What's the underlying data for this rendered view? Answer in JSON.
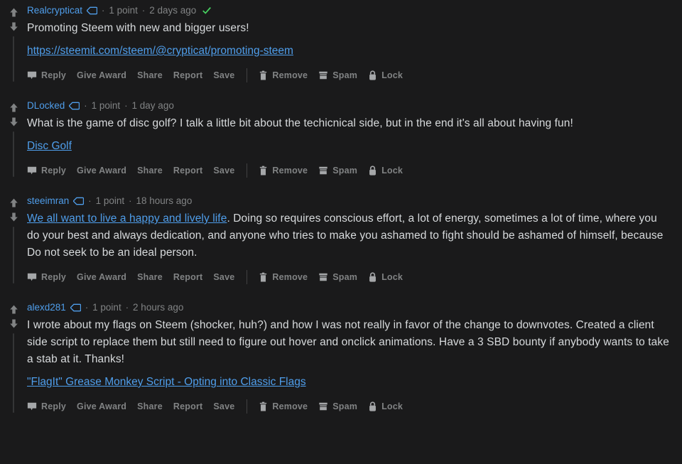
{
  "theme": {
    "background": "#1a1a1b",
    "text": "#d7dadc",
    "muted": "#818384",
    "link": "#4f9eeb",
    "threadline": "#343536",
    "verified_green": "#46d160",
    "icon_grey": "#818384"
  },
  "labels": {
    "points": "1 point",
    "separator": "·",
    "reply": "Reply",
    "give_award": "Give Award",
    "share": "Share",
    "report": "Report",
    "save": "Save",
    "remove": "Remove",
    "spam": "Spam",
    "lock": "Lock"
  },
  "icons": {
    "upvote": "upvote-arrow-icon",
    "downvote": "downvote-arrow-icon",
    "flair": "user-flair-tag-icon",
    "verified": "verified-checkmark-icon",
    "reply": "speech-bubble-icon",
    "remove": "trash-can-icon",
    "spam": "spam-box-icon",
    "lock": "padlock-icon"
  },
  "comments": [
    {
      "author": "Realcrypticat",
      "points": "1 point",
      "age": "2 days ago",
      "verified": true,
      "text": "Promoting Steem with new and bigger users!",
      "link_text": "https://steemit.com/steem/@crypticat/promoting-steem",
      "inline_link": null
    },
    {
      "author": "DLocked",
      "points": "1 point",
      "age": "1 day ago",
      "verified": false,
      "text": "What is the game of disc golf? I talk a little bit about the techicnical side, but in the end it's all about having fun!",
      "link_text": "Disc Golf",
      "inline_link": null
    },
    {
      "author": "steeimran",
      "points": "1 point",
      "age": "18 hours ago",
      "verified": false,
      "inline_link": "We all want to live a happy and lively life",
      "text": ". Doing so requires conscious effort, a lot of energy, sometimes a lot of time, where you do your best and always dedication, and anyone who tries to make you ashamed to fight should be ashamed of himself, because Do not seek to be an ideal person.",
      "link_text": null
    },
    {
      "author": "alexd281",
      "points": "1 point",
      "age": "2 hours ago",
      "verified": false,
      "text": "I wrote about my flags on Steem (shocker, huh?) and how I was not really in favor of the change to downvotes. Created a client side script to replace them but still need to figure out hover and onclick animations. Have a 3 SBD bounty if anybody wants to take a stab at it. Thanks!",
      "link_text": "\"FlagIt\" Grease Monkey Script - Opting into Classic Flags",
      "inline_link": null
    }
  ]
}
